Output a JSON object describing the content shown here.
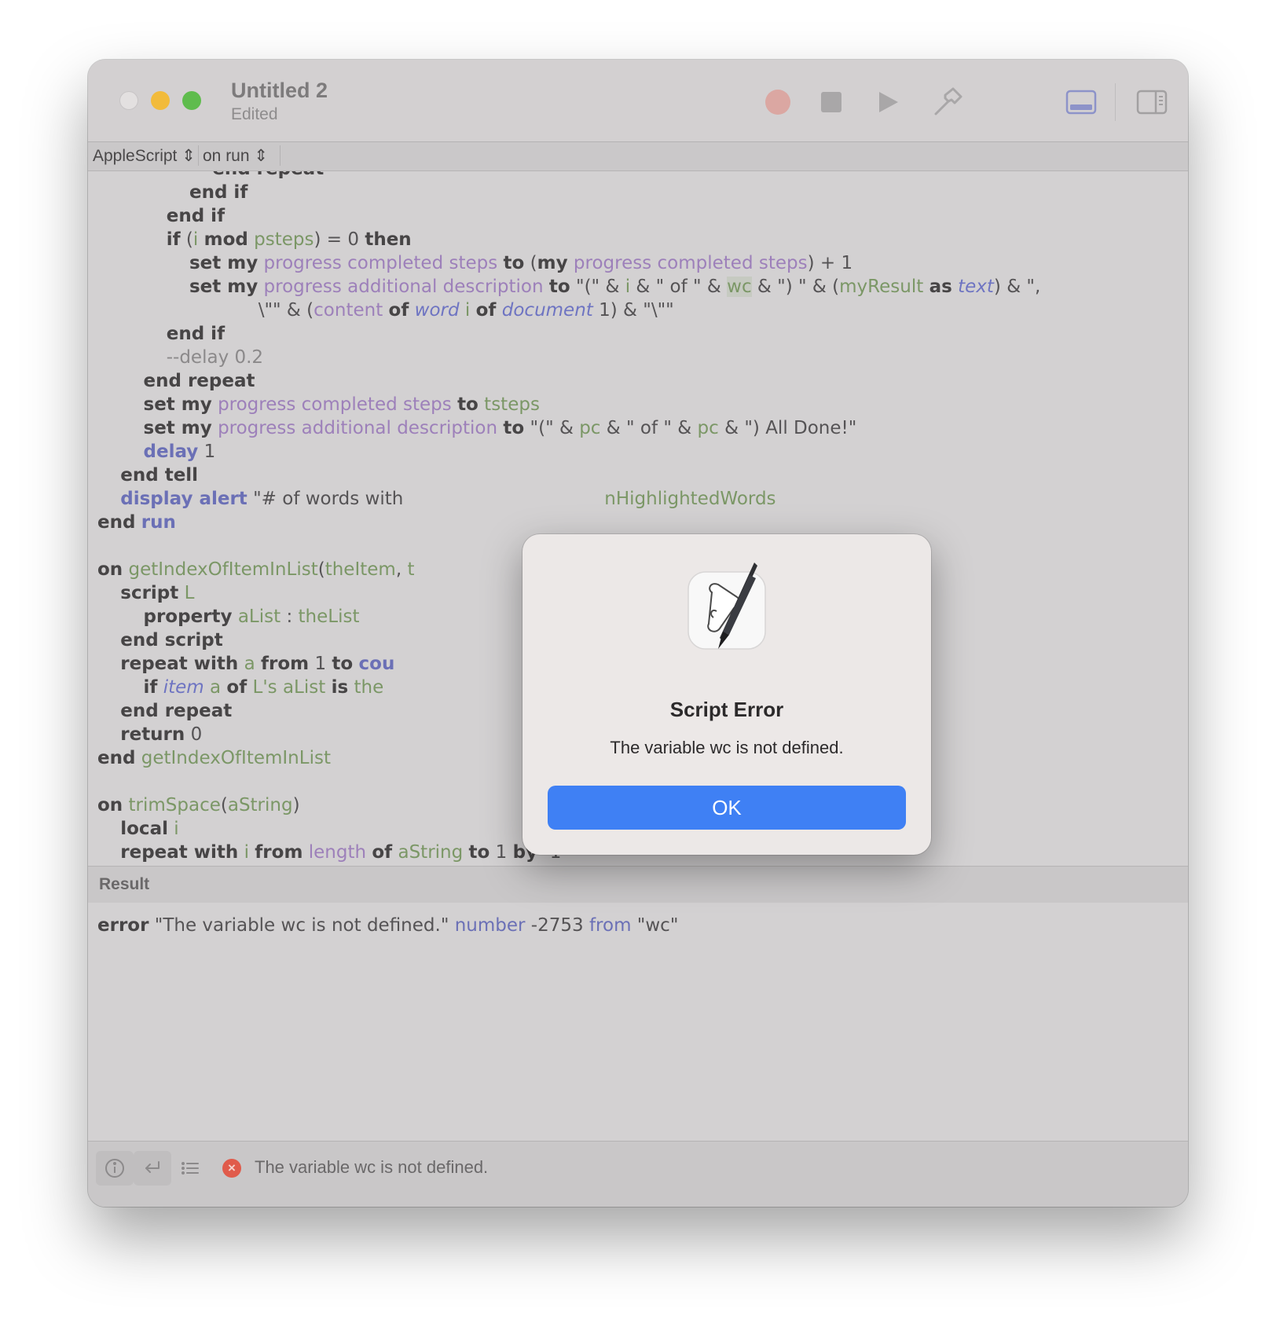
{
  "window": {
    "title": "Untitled 2",
    "subtitle": "Edited"
  },
  "toolbar": {
    "icons": [
      "record-icon",
      "stop-icon",
      "run-icon",
      "compile-icon",
      "show-log-icon",
      "show-inspector-icon"
    ]
  },
  "navbar": {
    "language": "AppleScript",
    "handler": "on run"
  },
  "editor": {
    "lines": [
      "end repeat",
      "end if",
      "end if",
      "if (i mod psteps) = 0 then",
      "set my progress completed steps to (my progress completed steps) + 1",
      "set my progress additional description to \"(\" & i & \" of \" & wc & \") \" & (myResult as text) & \",",
      "\\\"\" & (content of word i of document 1) & \"\\\"\"",
      "end if",
      "--delay 0.2",
      "end repeat",
      "set my progress completed steps to tsteps",
      "set my progress additional description to \"(\" & pc & \" of \" & pc & \") All Done!\"",
      "delay 1",
      "end tell",
      "display alert \"# of words with ... nHighlightedWords",
      "end run",
      "",
      "on getIndexOfItemInList(theItem, t",
      "script L",
      "property aList : theList",
      "end script",
      "repeat with a from 1 to cou",
      "if item a of L's aList is the",
      "end repeat",
      "return 0",
      "end getIndexOfItemInList",
      "",
      "on trimSpace(aString)",
      "local i",
      "repeat with i from length of aString to 1 by -1"
    ]
  },
  "result": {
    "label": "Result",
    "error_keyword": "error",
    "message": "\"The variable wc is not defined.\"",
    "number_keyword": "number",
    "number": "-2753",
    "from_keyword": "from",
    "from_value": "\"wc\""
  },
  "statusbar": {
    "message": "The variable wc is not defined.",
    "icons": [
      "info-icon",
      "reply-icon",
      "list-icon",
      "error-icon"
    ]
  },
  "dialog": {
    "title": "Script Error",
    "message": "The variable wc is not defined.",
    "ok_label": "OK",
    "icon": "script-editor-icon"
  },
  "colors": {
    "ok_button": "#3f80f4",
    "close_button": "#e3e0e0",
    "minimize_button": "#f2bb3b",
    "zoom_button": "#5fbc4d",
    "record_button": "#dba7a2",
    "keyword_blue": "#6b70b6",
    "property_purple": "#9d80ba",
    "variable_green": "#7b9766"
  }
}
